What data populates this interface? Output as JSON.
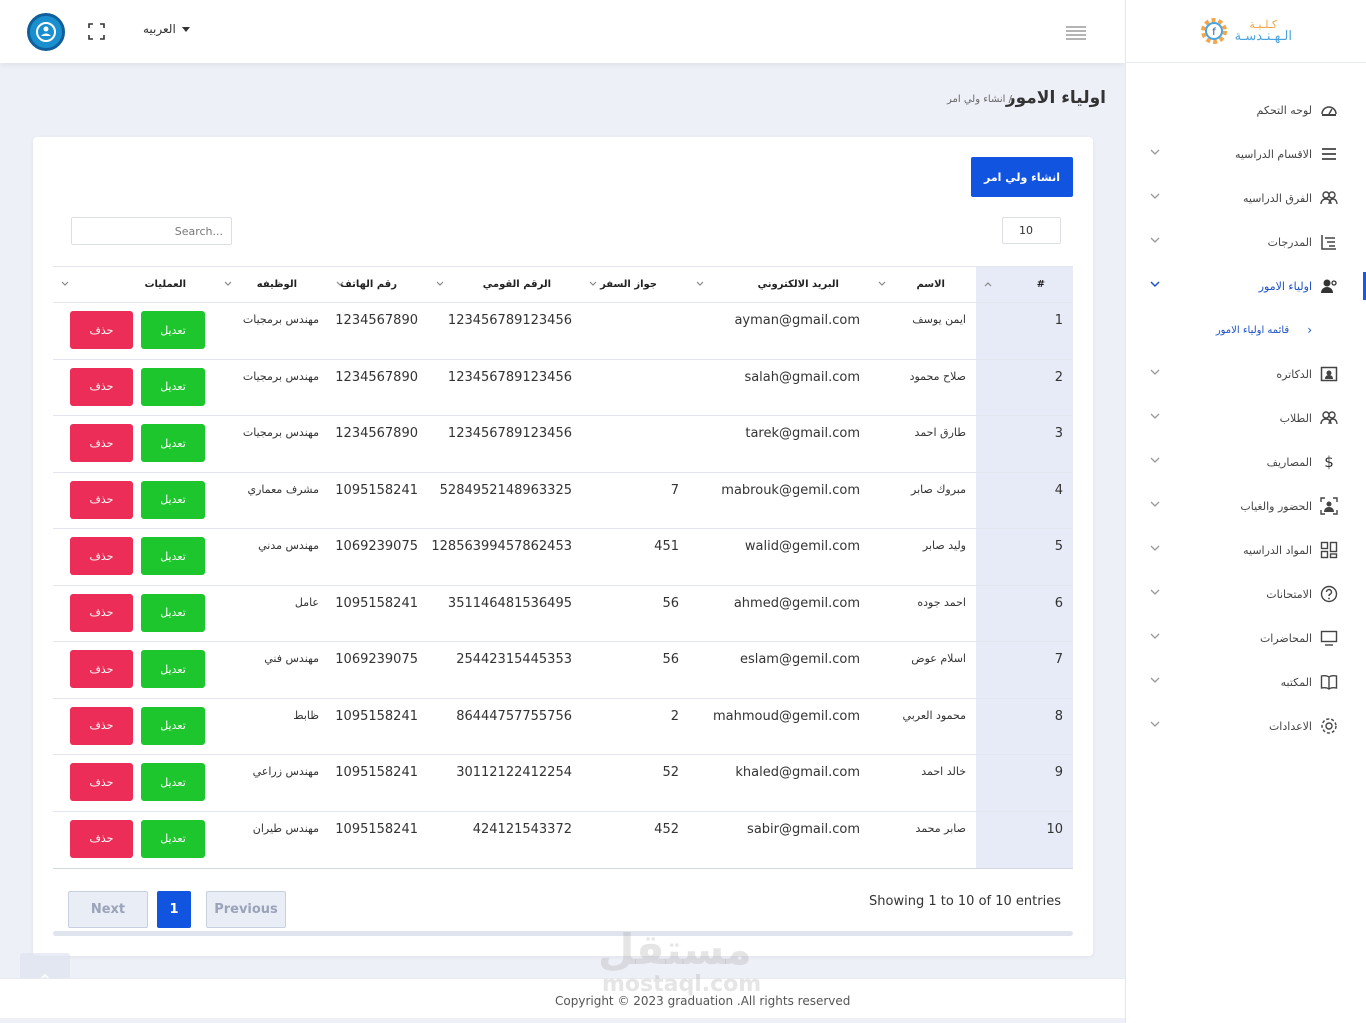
{
  "topbar": {
    "language": "العربيه"
  },
  "logo": {
    "line1": "كـلـيـة",
    "line2": "الـهـنـدسـة"
  },
  "page": {
    "title": "اولياء الامور",
    "breadcrumb": "/ انشاء ولي امر"
  },
  "sidebar": {
    "items": [
      {
        "label": "لوحه التحكم",
        "icon": "dashboard-icon",
        "has_chevron": false
      },
      {
        "label": "الاقسام الدراسيه",
        "icon": "list-icon",
        "has_chevron": true
      },
      {
        "label": "الفرق الدراسيه",
        "icon": "users-icon",
        "has_chevron": true
      },
      {
        "label": "المدرجات",
        "icon": "tiers-icon",
        "has_chevron": true
      },
      {
        "label": "اولياء الامور",
        "icon": "user-settings-icon",
        "has_chevron": true,
        "active": true
      },
      {
        "label": "الدكاتره",
        "icon": "id-card-icon",
        "has_chevron": true
      },
      {
        "label": "الطلاب",
        "icon": "users-icon",
        "has_chevron": true
      },
      {
        "label": "المصاريف",
        "icon": "dollar-icon",
        "has_chevron": true
      },
      {
        "label": "الحضور والغياب",
        "icon": "person-frame-icon",
        "has_chevron": true
      },
      {
        "label": "المواد الدراسيه",
        "icon": "grid-icon",
        "has_chevron": true
      },
      {
        "label": "الامتحانات",
        "icon": "question-icon",
        "has_chevron": true
      },
      {
        "label": "المحاضرات",
        "icon": "monitor-icon",
        "has_chevron": true
      },
      {
        "label": "المكتبه",
        "icon": "book-icon",
        "has_chevron": true
      },
      {
        "label": "الاعدادات",
        "icon": "gear-icon",
        "has_chevron": true
      }
    ],
    "sub_item": "قائمه اولياء الامور"
  },
  "card": {
    "create_button": "انشاء ولي امر",
    "search_placeholder": "Search...",
    "per_page": "10"
  },
  "table": {
    "headers": {
      "num": "#",
      "name": "الاسم",
      "email": "البريد الالكتروني",
      "passport": "جواز السفر",
      "national_id": "الرقم القومي",
      "phone": "رقم الهاتف",
      "job": "الوظيفه",
      "actions": "العمليات"
    },
    "edit_label": "تعديل",
    "delete_label": "حذف",
    "rows": [
      {
        "num": "1",
        "name": "ايمن يوسف",
        "email": "ayman@gmail.com",
        "passport": "",
        "national_id": "123456789123456",
        "phone": "1234567890",
        "job": "مهندس برمجيات"
      },
      {
        "num": "2",
        "name": "صلاح محمود",
        "email": "salah@gmail.com",
        "passport": "",
        "national_id": "123456789123456",
        "phone": "1234567890",
        "job": "مهندس برمجيات"
      },
      {
        "num": "3",
        "name": "طارق احمد",
        "email": "tarek@gmail.com",
        "passport": "",
        "national_id": "123456789123456",
        "phone": "1234567890",
        "job": "مهندس برمجيات"
      },
      {
        "num": "4",
        "name": "مبروك صابر",
        "email": "mabrouk@gemil.com",
        "passport": "7",
        "national_id": "5284952148963325",
        "phone": "1095158241",
        "job": "مشرف معماري"
      },
      {
        "num": "5",
        "name": "وليد صابر",
        "email": "walid@gemil.com",
        "passport": "451",
        "national_id": "12856399457862453",
        "phone": "1069239075",
        "job": "مهندس مدني"
      },
      {
        "num": "6",
        "name": "احمد جوده",
        "email": "ahmed@gemil.com",
        "passport": "56",
        "national_id": "351146481536495",
        "phone": "1095158241",
        "job": "عامل"
      },
      {
        "num": "7",
        "name": "اسلام عوض",
        "email": "eslam@gemil.com",
        "passport": "56",
        "national_id": "25442315445353",
        "phone": "1069239075",
        "job": "مهندس فني"
      },
      {
        "num": "8",
        "name": "محمود العربي",
        "email": "mahmoud@gemil.com",
        "passport": "2",
        "national_id": "86444757755756",
        "phone": "1095158241",
        "job": "ظابط"
      },
      {
        "num": "9",
        "name": "خالد احمد",
        "email": "khaled@gmail.com",
        "passport": "52",
        "national_id": "30112122412254",
        "phone": "1095158241",
        "job": "مهندس زراعي"
      },
      {
        "num": "10",
        "name": "صابر محمد",
        "email": "sabir@gmail.com",
        "passport": "452",
        "national_id": "424121543372",
        "phone": "1095158241",
        "job": "مهندس طيران"
      }
    ]
  },
  "pagination": {
    "showing": "Showing 1 to 10 of 10 entries",
    "next": "Next",
    "current": "1",
    "previous": "Previous"
  },
  "footer": {
    "copyright": "Copyright © 2023 graduation .All rights reserved"
  },
  "watermark": {
    "arabic": "مستقل",
    "latin": "mostaql.com"
  },
  "colors": {
    "primary": "#1154e0",
    "edit": "#1ec62e",
    "delete": "#ec2d57",
    "background": "#eef0f8"
  }
}
